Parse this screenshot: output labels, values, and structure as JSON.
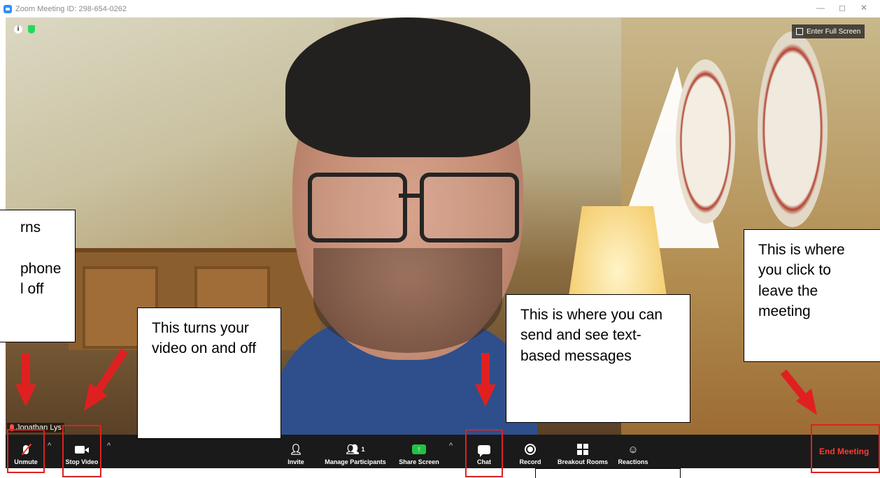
{
  "window": {
    "title": "Zoom Meeting ID: 298-654-0262",
    "minimize": "—",
    "restore": "◻",
    "close": "✕"
  },
  "video": {
    "info_glyph": "i",
    "fullscreen_label": "Enter Full Screen",
    "participant_name": "Jonathan Lys"
  },
  "toolbar": {
    "unmute": "Unmute",
    "stop_video": "Stop Video",
    "invite": "Invite",
    "manage_participants": "Manage Participants",
    "participant_count": "1",
    "share_screen": "Share Screen",
    "chat": "Chat",
    "record": "Record",
    "breakout_rooms": "Breakout Rooms",
    "reactions": "Reactions",
    "end_meeting": "End Meeting",
    "caret": "^"
  },
  "annotations": {
    "mic_callout": "rns\n\nphone\nl off",
    "video_callout": "This turns your video on and off",
    "chat_callout": "This is where you can send and see text-based messages",
    "leave_callout": "This is where you click to leave the meeting"
  },
  "colors": {
    "toolbar_bg": "#1a1a1a",
    "end_meeting": "#ff3b30",
    "annotation_red": "#e02020",
    "share_green": "#23c246"
  }
}
